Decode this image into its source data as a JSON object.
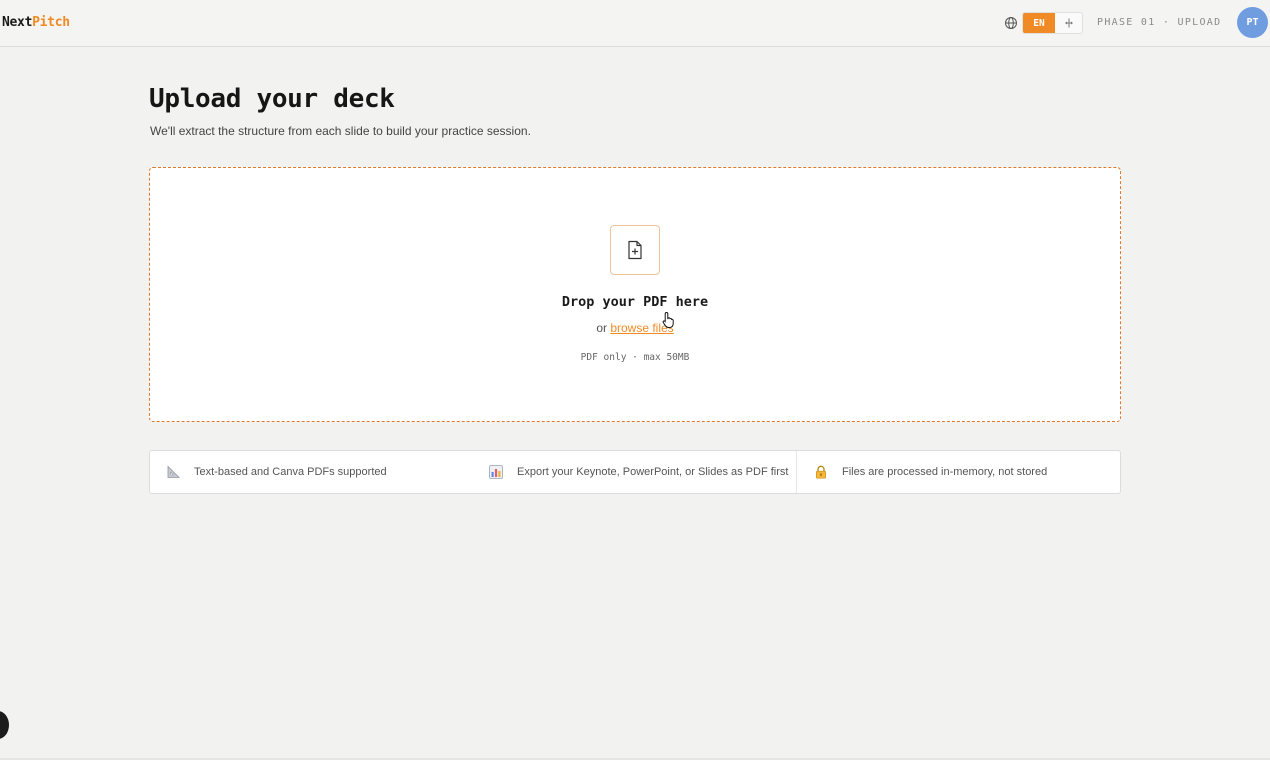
{
  "header": {
    "logo_part1": "Next",
    "logo_part2": "Pitch",
    "lang_active": "EN",
    "lang_alt_icon": "split-icon",
    "phase_text": "PHASE 01 · UPLOAD",
    "avatar_initials": "PT",
    "colors": {
      "accent": "#f08a24",
      "avatar": "#6f9de0"
    }
  },
  "main": {
    "title": "Upload your deck",
    "subtitle": "We'll extract the structure from each slide to build your practice session.",
    "dropzone": {
      "title": "Drop your PDF here",
      "or_text": "or ",
      "browse_link": "browse files",
      "hint": "PDF only · max 50MB"
    },
    "info": [
      {
        "icon": "triangle-ruler-icon",
        "text": "Text-based and Canva PDFs supported"
      },
      {
        "icon": "bar-chart-icon",
        "text": "Export your Keynote, PowerPoint, or Slides as PDF first"
      },
      {
        "icon": "lock-icon",
        "text": "Files are processed in-memory, not stored"
      }
    ]
  }
}
